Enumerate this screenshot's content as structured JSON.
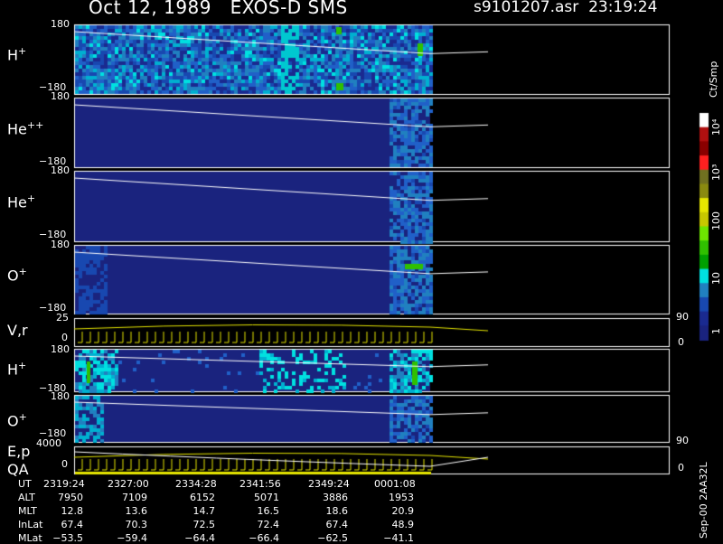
{
  "header": {
    "title": "Oct 12, 1989   EXOS-D SMS",
    "file": "s9101207.asr",
    "time": "23:19:24"
  },
  "panels": {
    "hplus1": {
      "label": "H",
      "sup": "+",
      "ytop": "180",
      "ybot": "−180"
    },
    "hepp": {
      "label": "He",
      "sup": "++",
      "ytop": "180",
      "ybot": "−180"
    },
    "hep": {
      "label": "He",
      "sup": "+",
      "ytop": "180",
      "ybot": "−180"
    },
    "op1": {
      "label": "O",
      "sup": "+",
      "ytop": "180",
      "ybot": "−180"
    },
    "vr": {
      "label": "V,r",
      "ytop": "25",
      "ybot": "0",
      "rtop": "90",
      "rbot": "0"
    },
    "hplus2": {
      "label": "H",
      "sup": "+",
      "ytop": "180",
      "ybot": "−180"
    },
    "op2": {
      "label": "O",
      "sup": "+",
      "ytop": "180",
      "ybot": "−180"
    },
    "ep": {
      "label": "E,p",
      "label2": "QA",
      "ytop": "4000",
      "ybot": "0",
      "rtop": "90",
      "rbot": "0"
    }
  },
  "colorbar": {
    "unit": "Ct/Smp",
    "ticks": [
      "10⁴",
      "10³",
      "100",
      "10",
      "1"
    ],
    "colors": [
      "#ffffff",
      "#b01010",
      "#8a0000",
      "#ff2020",
      "#707020",
      "#8a8a10",
      "#e6e600",
      "#c8c800",
      "#6ee600",
      "#30c000",
      "#00a000",
      "#00e0e0",
      "#2080c0",
      "#1848b0",
      "#1a2a90",
      "#1a237e"
    ]
  },
  "ephemeris": {
    "labels": [
      "UT",
      "ALT",
      "MLT",
      "InLat",
      "MLat"
    ],
    "columns": [
      [
        "2319:24",
        "7950",
        "12.8",
        "67.4",
        "−53.5"
      ],
      [
        "2327:00",
        "7109",
        "13.6",
        "70.3",
        "−59.4"
      ],
      [
        "2334:28",
        "6152",
        "14.7",
        "72.5",
        "−64.4"
      ],
      [
        "2341:56",
        "5071",
        "16.5",
        "72.4",
        "−66.4"
      ],
      [
        "2349:24",
        "3886",
        "18.6",
        "67.4",
        "−62.5"
      ],
      [
        "0001:08",
        "1953",
        "20.9",
        "48.9",
        "−41.1"
      ]
    ]
  },
  "footer": {
    "stamp": "Sep-00  2AA32L"
  },
  "chart_data": {
    "type": "heatmap",
    "title": "Oct 12, 1989   EXOS-D SMS",
    "x": [
      "2319:24",
      "2327:00",
      "2334:28",
      "2341:56",
      "2349:24",
      "0001:08"
    ],
    "panels": [
      {
        "name": "H+",
        "ylim": [
          -180,
          180
        ]
      },
      {
        "name": "He++",
        "ylim": [
          -180,
          180
        ]
      },
      {
        "name": "He+",
        "ylim": [
          -180,
          180
        ]
      },
      {
        "name": "O+",
        "ylim": [
          -180,
          180
        ]
      },
      {
        "name": "V,r",
        "ylim": [
          0,
          25
        ],
        "right_ylim": [
          0,
          90
        ]
      },
      {
        "name": "H+",
        "ylim": [
          -180,
          180
        ]
      },
      {
        "name": "O+",
        "ylim": [
          -180,
          180
        ]
      },
      {
        "name": "E,p",
        "ylim": [
          0,
          4000
        ],
        "right_ylim": [
          0,
          90
        ]
      }
    ],
    "colorbar": {
      "label": "Ct/Smp",
      "scale": "log",
      "range": [
        1,
        10000
      ]
    }
  }
}
